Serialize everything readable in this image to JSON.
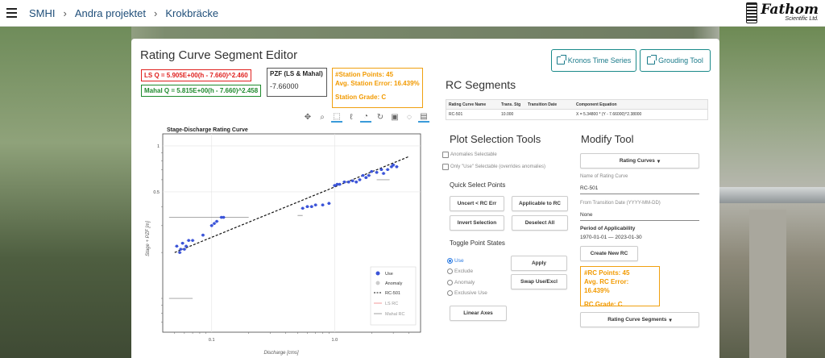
{
  "breadcrumb": [
    "SMHI",
    "Andra projektet",
    "Krokbräcke"
  ],
  "logo": {
    "name": "Fathom",
    "sub": "Scientific Ltd."
  },
  "editor": {
    "title": "Rating Curve Segment Editor",
    "kronos_button": "Kronos Time Series",
    "grouding_button": "Grouding Tool",
    "ls_equation": "LS Q = 5.905E+00(h - 7.660)^2.460",
    "mahal_equation": "Mahal Q = 5.815E+00(h - 7.660)^2.458",
    "pzf_header": "PZF (LS & Mahal)",
    "pzf_value": "-7.66000",
    "station_points": "#Station Points: 45",
    "station_error": "Avg. Station Error: 16.439%",
    "station_grade": "Station Grade: C"
  },
  "rc_segments": {
    "title": "RC Segments",
    "columns": [
      "Rating Curve Name",
      "Trans. Stg",
      "Transition Date",
      "Component Equation"
    ],
    "rows": [
      [
        "RC-501",
        "10.000",
        "",
        "X = 5.34800 * (Y - 7.66000)^2.38000"
      ]
    ]
  },
  "plot_selection": {
    "title": "Plot Selection Tools",
    "anomalies_selectable": "Anomalies Selectable",
    "only_use_selectable": "Only \"Use\" Selectable (overrides anomalies)",
    "quick_select_title": "Quick Select Points",
    "uncert_btn": "Uncert < RC Err",
    "applicable_btn": "Applicable to RC",
    "invert_btn": "Invert Selection",
    "deselect_btn": "Deselect All",
    "toggle_title": "Toggle Point States",
    "radio_options": [
      "Use",
      "Exclude",
      "Anomaly",
      "Exclusive Use"
    ],
    "apply_btn": "Apply",
    "swap_btn": "Swap Use/Excl",
    "linear_axes_btn": "Linear Axes"
  },
  "modify_tool": {
    "title": "Modify Tool",
    "rating_curves_dropdown": "Rating Curves",
    "name_label": "Name of Rating Curve",
    "name_value": "RC-501",
    "from_date_label": "From Transition Date (YYYY-MM-DD)",
    "from_date_value": "None",
    "period_label": "Period of Applicability",
    "period_value": "1970-01-01 — 2023-01-30",
    "create_btn": "Create New RC",
    "rc_points": "#RC Points: 45",
    "rc_error": "Avg. RC Error: 16.439%",
    "rc_grade": "RC Grade: C",
    "segments_dropdown": "Rating Curve Segments"
  },
  "chart_data": {
    "type": "scatter",
    "title": "Stage-Discharge Rating Curve",
    "xlabel": "Discharge [cms]",
    "ylabel": "Stage + PZF [m]",
    "x_scale": "log",
    "y_scale": "log",
    "xlim": [
      0.04,
      5
    ],
    "ylim": [
      0.06,
      1.2
    ],
    "x_ticks": [
      "0.1",
      "1.0"
    ],
    "y_ticks": [
      "1",
      "0.5"
    ],
    "legend": [
      "Use",
      "Anomaly",
      "RC-501",
      "LS RC",
      "Mahal RC"
    ],
    "legend_position": "bottom-right",
    "series": [
      {
        "name": "Use",
        "color": "#3b54d8",
        "x": [
          0.052,
          0.055,
          0.056,
          0.058,
          0.06,
          0.062,
          0.065,
          0.07,
          0.085,
          0.1,
          0.105,
          0.11,
          0.12,
          0.125,
          0.55,
          0.6,
          0.65,
          0.7,
          0.8,
          0.9,
          1.0,
          1.05,
          1.1,
          1.2,
          1.3,
          1.4,
          1.5,
          1.6,
          1.7,
          1.8,
          1.9,
          2.0,
          2.2,
          2.4,
          2.5,
          2.7,
          2.9,
          3.0,
          3.2
        ],
        "y": [
          0.22,
          0.2,
          0.21,
          0.23,
          0.21,
          0.22,
          0.24,
          0.24,
          0.26,
          0.3,
          0.31,
          0.32,
          0.34,
          0.34,
          0.39,
          0.4,
          0.4,
          0.41,
          0.41,
          0.42,
          0.55,
          0.56,
          0.56,
          0.58,
          0.58,
          0.59,
          0.58,
          0.6,
          0.64,
          0.62,
          0.64,
          0.68,
          0.67,
          0.7,
          0.66,
          0.7,
          0.73,
          0.75,
          0.73
        ]
      },
      {
        "name": "RC-501",
        "color": "#111111",
        "x": [
          0.05,
          4.0
        ],
        "y": [
          0.2,
          0.85
        ]
      }
    ]
  }
}
